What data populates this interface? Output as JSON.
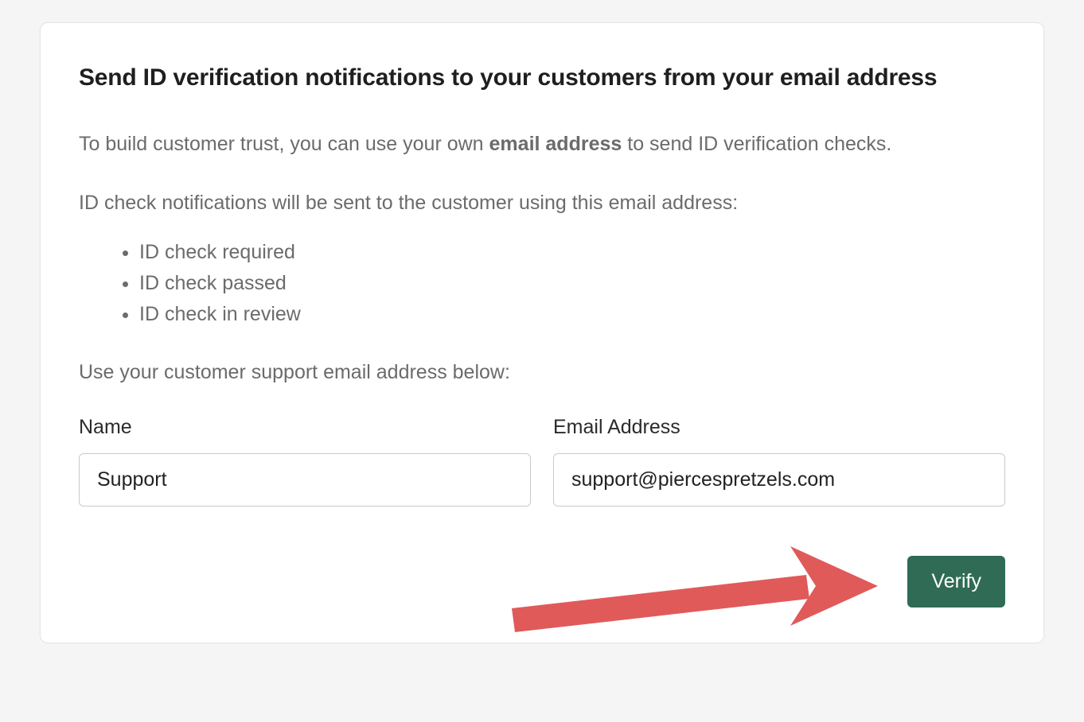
{
  "title": "Send ID verification notifications to your customers from your email address",
  "description": {
    "prefix": "To build customer trust, you can use your own ",
    "strong": "email address",
    "suffix": " to send ID verification checks."
  },
  "subhead": "ID check notifications will be sent to the customer using this email address:",
  "bullets": [
    "ID check required",
    "ID check passed",
    "ID check in review"
  ],
  "instruction": "Use your customer support email address below:",
  "form": {
    "name_label": "Name",
    "name_value": "Support",
    "email_label": "Email Address",
    "email_value": "support@piercespretzels.com"
  },
  "actions": {
    "verify_label": "Verify"
  },
  "colors": {
    "primary_button": "#2f6b55",
    "arrow": "#e05a5a"
  }
}
